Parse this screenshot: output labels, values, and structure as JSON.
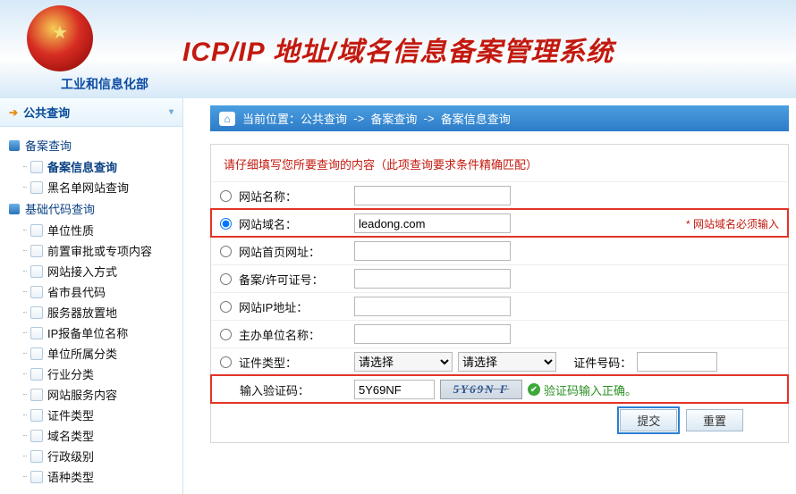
{
  "header": {
    "ministry": "工业和信息化部",
    "title": "ICP/IP 地址/域名信息备案管理系统"
  },
  "sidebar": {
    "header": "公共查询",
    "cat1": "备案查询",
    "cat1_items": [
      "备案信息查询",
      "黑名单网站查询"
    ],
    "cat2": "基础代码查询",
    "cat2_items": [
      "单位性质",
      "前置审批或专项内容",
      "网站接入方式",
      "省市县代码",
      "服务器放置地",
      "IP报备单位名称",
      "单位所属分类",
      "行业分类",
      "网站服务内容",
      "证件类型",
      "域名类型",
      "行政级别",
      "语种类型"
    ]
  },
  "crumb": {
    "label": "当前位置：",
    "p1": "公共查询",
    "p2": "备案查询",
    "p3": "备案信息查询"
  },
  "form": {
    "instr": "请仔细填写您所要查询的内容（此项查询要求条件精确匹配）",
    "r_name": "网站名称：",
    "r_domain": "网站域名：",
    "r_domain_val": "leadong.com",
    "r_domain_req": "* 网站域名必须输入",
    "r_home": "网站首页网址：",
    "r_license": "备案/许可证号：",
    "r_ip": "网站IP地址：",
    "r_org": "主办单位名称：",
    "r_cert": "证件类型：",
    "r_cert_sel": "请选择",
    "r_cert_no": "证件号码：",
    "r_captcha": "输入验证码：",
    "r_captcha_val": "5Y69NF",
    "r_captcha_img": "5Y69N F",
    "r_captcha_ok": "验证码输入正确。",
    "btn_submit": "提交",
    "btn_reset": "重置"
  }
}
